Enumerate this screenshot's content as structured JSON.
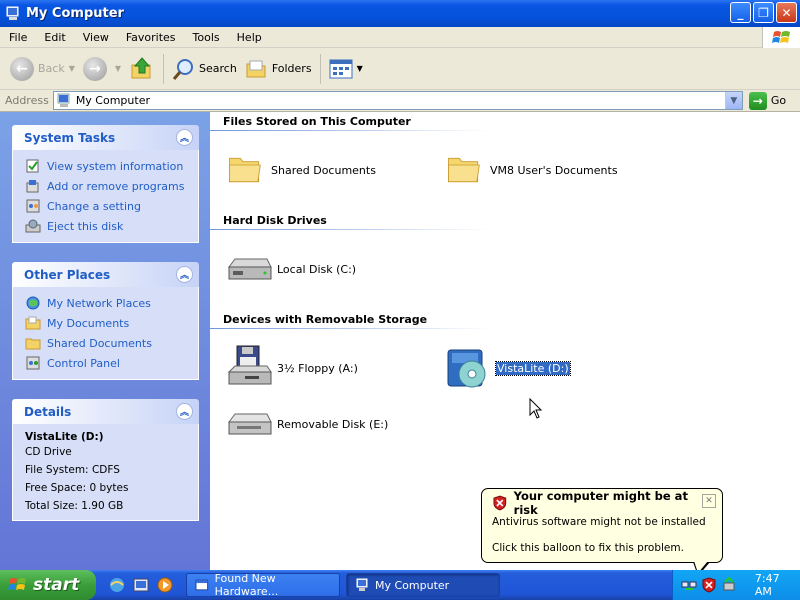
{
  "window": {
    "title": "My Computer"
  },
  "menu": [
    "File",
    "Edit",
    "View",
    "Favorites",
    "Tools",
    "Help"
  ],
  "toolbar": {
    "back": "Back",
    "search": "Search",
    "folders": "Folders"
  },
  "address": {
    "label": "Address",
    "value": "My Computer",
    "go": "Go"
  },
  "sidebar": {
    "system_tasks": {
      "title": "System Tasks",
      "items": [
        "View system information",
        "Add or remove programs",
        "Change a setting",
        "Eject this disk"
      ]
    },
    "other_places": {
      "title": "Other Places",
      "items": [
        "My Network Places",
        "My Documents",
        "Shared Documents",
        "Control Panel"
      ]
    },
    "details": {
      "title": "Details",
      "name": "VistaLite (D:)",
      "type": "CD Drive",
      "file_system": "File System: CDFS",
      "free_space": "Free Space: 0 bytes",
      "total_size": "Total Size: 1.90 GB"
    }
  },
  "content": {
    "groups": [
      {
        "title": "Files Stored on This Computer",
        "items": [
          "Shared Documents",
          "VM8 User's Documents"
        ]
      },
      {
        "title": "Hard Disk Drives",
        "items": [
          "Local Disk (C:)"
        ]
      },
      {
        "title": "Devices with Removable Storage",
        "items": [
          "3½ Floppy (A:)",
          "VistaLite (D:)",
          "Removable Disk (E:)"
        ]
      }
    ],
    "selected_item": "VistaLite (D:)"
  },
  "balloon": {
    "title": "Your computer might be at risk",
    "line1": "Antivirus software might not be installed",
    "line2": "Click this balloon to fix this problem."
  },
  "taskbar": {
    "start": "start",
    "tasks": [
      "Found New Hardware...",
      "My Computer"
    ],
    "clock": "7:47 AM"
  }
}
